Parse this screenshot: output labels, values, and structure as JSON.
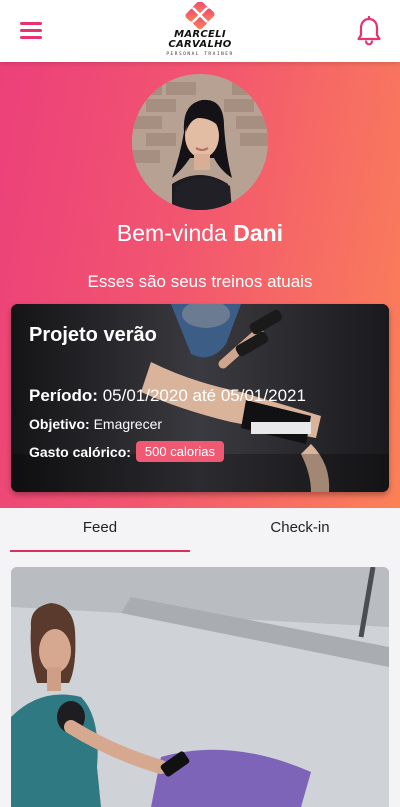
{
  "header": {
    "menu_icon": "hamburger-menu-icon",
    "logo_line1": "MARCELI",
    "logo_line2": "CARVALHO",
    "logo_tagline": "PERSONAL TRAINER",
    "notification_icon": "bell-icon",
    "brand_color": "#e8336f"
  },
  "hero": {
    "greeting_prefix": "Bem-vinda ",
    "user_name": "Dani",
    "subtitle": "Esses são seus treinos atuais",
    "gradient_start": "#ec407a",
    "gradient_end": "#fb8158"
  },
  "workout_card": {
    "title": "Projeto verão",
    "period_label": "Período:",
    "period_value": "05/01/2020 até 05/01/2021",
    "goal_label": "Objetivo:",
    "goal_value": "Emagrecer",
    "calories_label": "Gasto calórico:",
    "calories_value": "500 calorias"
  },
  "tabs": [
    {
      "label": "Feed",
      "active": true
    },
    {
      "label": "Check-in",
      "active": false
    }
  ],
  "feed": {
    "post_image": "woman-with-phone-on-yoga-mat-photo"
  }
}
